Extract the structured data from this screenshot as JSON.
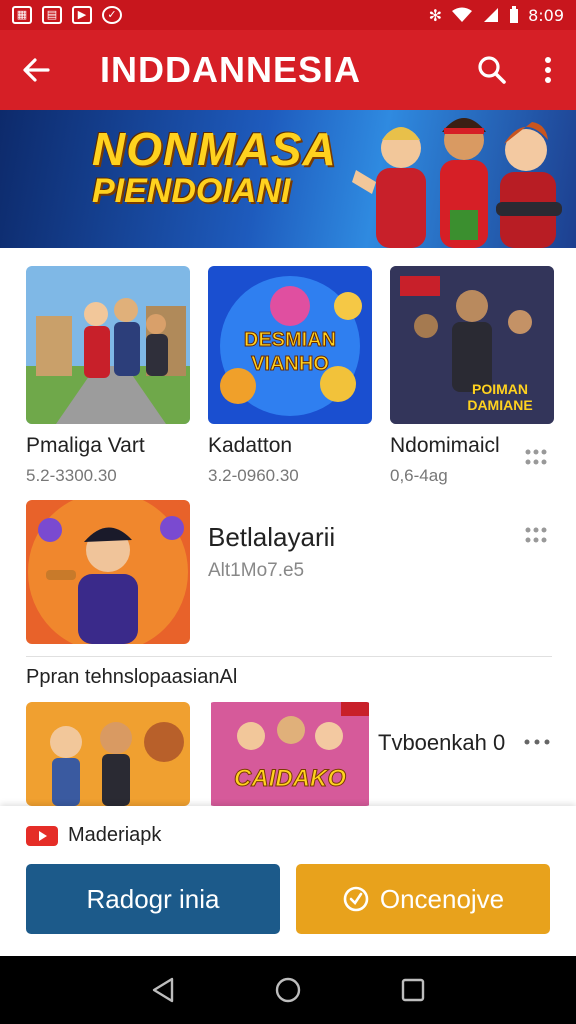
{
  "status_bar": {
    "left_icons": [
      "image-icon",
      "gallery-icon",
      "video-icon",
      "messenger-icon"
    ],
    "time": "8:09",
    "right_icons": [
      "bluetooth-icon",
      "wifi-icon",
      "signal-icon",
      "battery-icon"
    ]
  },
  "app_bar": {
    "title": "INDDANNESIA",
    "back_icon": "arrow-left-icon",
    "search_icon": "search-icon",
    "menu_icon": "more-vert-icon"
  },
  "banner": {
    "line1": "NONMASA",
    "line2": "PIENDOIANI"
  },
  "grid": {
    "items": [
      {
        "title": "Pmaliga Vart",
        "subtitle": "5.2-3300.30",
        "art_text": ""
      },
      {
        "title": "Kadatton",
        "subtitle": "3.2-0960.30",
        "art_text": "DESMIAN VIANHO"
      },
      {
        "title": "Ndomimaicl",
        "subtitle": "0,6-4ag",
        "art_text": "POIMAN DAMIANE"
      }
    ]
  },
  "featured": {
    "title": "Betlalayarii",
    "subtitle": "Alt1Mo7.e5"
  },
  "section": {
    "title": "Ppran tehnslopaasianAl",
    "row_label": "Tvboenkah 0",
    "row_art_text": "CAIDAKO"
  },
  "bottom": {
    "source_label": "Maderiapk",
    "primary_button": "Radogr inia",
    "secondary_button": "Oncenojve"
  },
  "colors": {
    "app_bar": "#d61f26",
    "status_bar": "#c8161d",
    "primary_button": "#1c5a8a",
    "secondary_button": "#e8a21c"
  },
  "nav": {
    "back": "triangle-back-icon",
    "home": "circle-home-icon",
    "recents": "square-recents-icon"
  }
}
